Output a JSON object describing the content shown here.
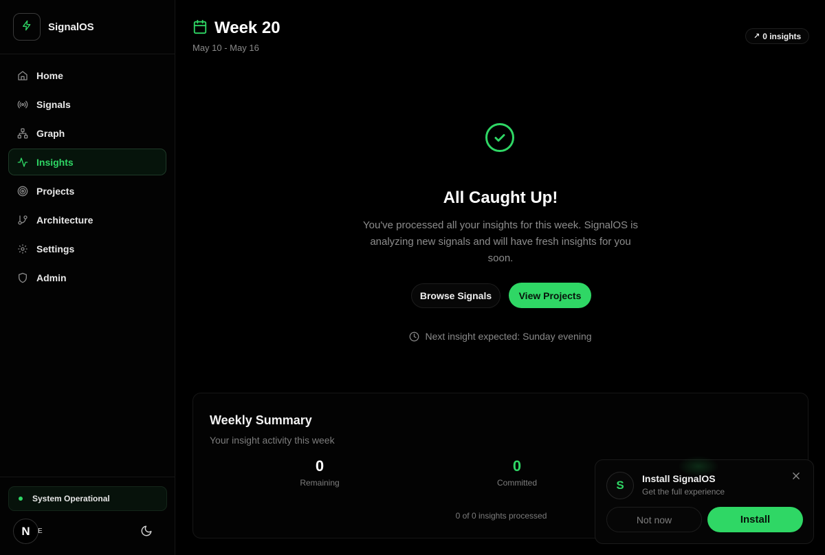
{
  "brand": {
    "name": "SignalOS",
    "logo_icon": "lightning-icon"
  },
  "colors": {
    "accent": "#2fd765",
    "background": "#000000",
    "muted_text": "#8a8a8a"
  },
  "sidebar": {
    "items": [
      {
        "label": "Home",
        "icon": "home-icon",
        "active": false
      },
      {
        "label": "Signals",
        "icon": "radio-signal-icon",
        "active": false
      },
      {
        "label": "Graph",
        "icon": "network-icon",
        "active": false
      },
      {
        "label": "Insights",
        "icon": "activity-icon",
        "active": true
      },
      {
        "label": "Projects",
        "icon": "target-icon",
        "active": false
      },
      {
        "label": "Architecture",
        "icon": "git-branch-icon",
        "active": false
      },
      {
        "label": "Settings",
        "icon": "gear-icon",
        "active": false
      },
      {
        "label": "Admin",
        "icon": "shield-icon",
        "active": false
      }
    ],
    "status": "System Operational",
    "avatar_letter": "N",
    "avatar_tail": "E",
    "theme_icon": "moon-icon"
  },
  "header": {
    "title": "Week 20",
    "date_range": "May 10 - May 16",
    "insights_badge": "0 insights"
  },
  "empty_state": {
    "title": "All Caught Up!",
    "description": "You've processed all your insights for this week. SignalOS is analyzing new signals and will have fresh insights for you soon.",
    "browse_button": "Browse Signals",
    "projects_button": "View Projects",
    "next_insight": "Next insight expected: Sunday evening"
  },
  "summary": {
    "title": "Weekly Summary",
    "subtitle": "Your insight activity this week",
    "stats": [
      {
        "value": "0",
        "label": "Remaining"
      },
      {
        "value": "0",
        "label": "Committed"
      }
    ],
    "progress": "0 of 0 insights processed"
  },
  "install_prompt": {
    "logo_letter": "S",
    "title": "Install SignalOS",
    "subtitle": "Get the full experience",
    "dismiss": "Not now",
    "install": "Install"
  }
}
